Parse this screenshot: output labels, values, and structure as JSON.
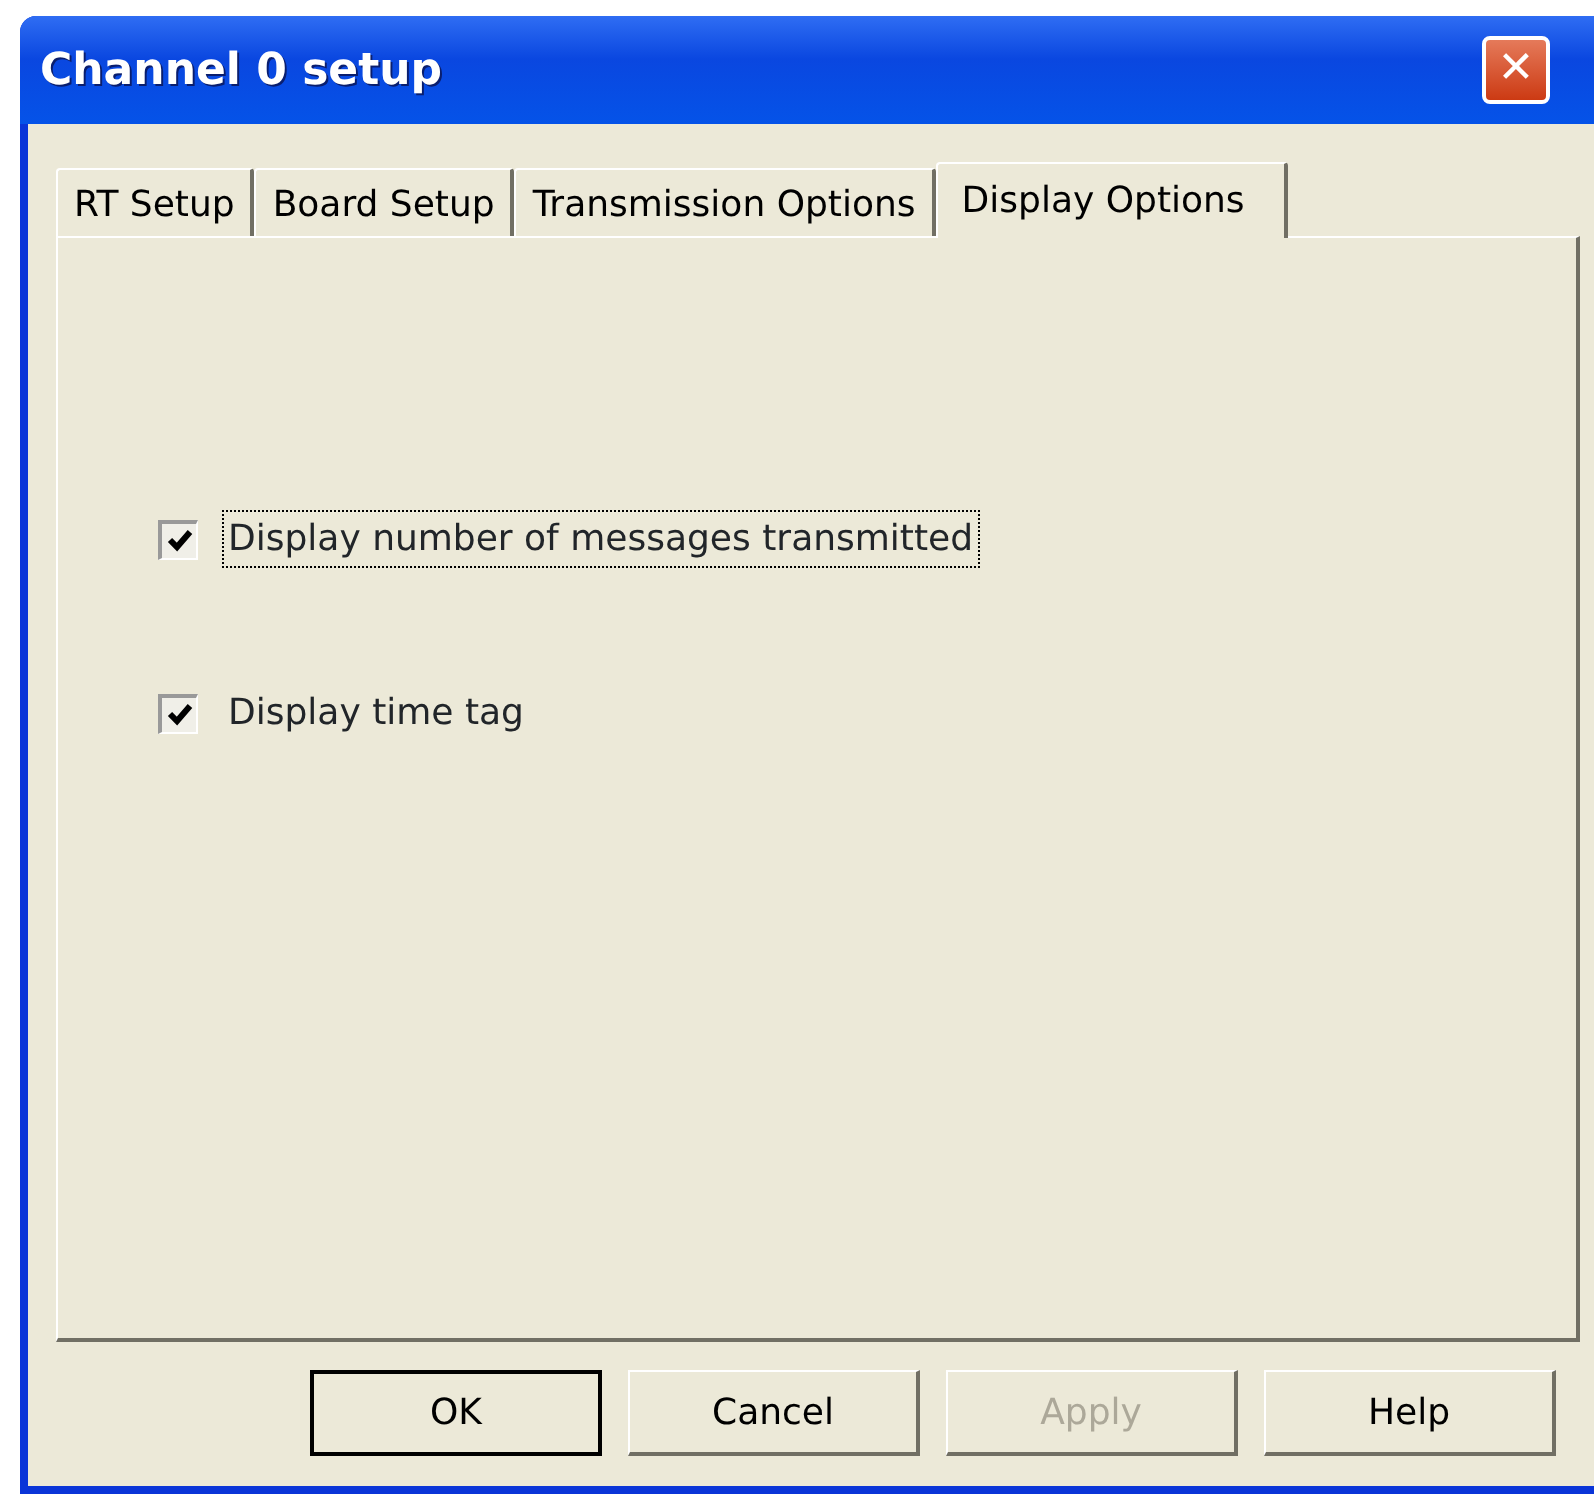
{
  "window": {
    "title": "Channel 0 setup",
    "close_button": "✕"
  },
  "tabs": [
    {
      "label": "RT Setup",
      "selected": false
    },
    {
      "label": "Board Setup",
      "selected": false
    },
    {
      "label": "Transmission Options",
      "selected": false
    },
    {
      "label": "Display Options",
      "selected": true
    }
  ],
  "options": [
    {
      "label": "Display number of messages transmitted",
      "checked": true,
      "focused": true
    },
    {
      "label": "Display time tag",
      "checked": true,
      "focused": false
    }
  ],
  "buttons": [
    {
      "label": "OK",
      "default": true,
      "disabled": false
    },
    {
      "label": "Cancel",
      "default": false,
      "disabled": false
    },
    {
      "label": "Apply",
      "default": false,
      "disabled": true
    },
    {
      "label": "Help",
      "default": false,
      "disabled": false
    }
  ]
}
